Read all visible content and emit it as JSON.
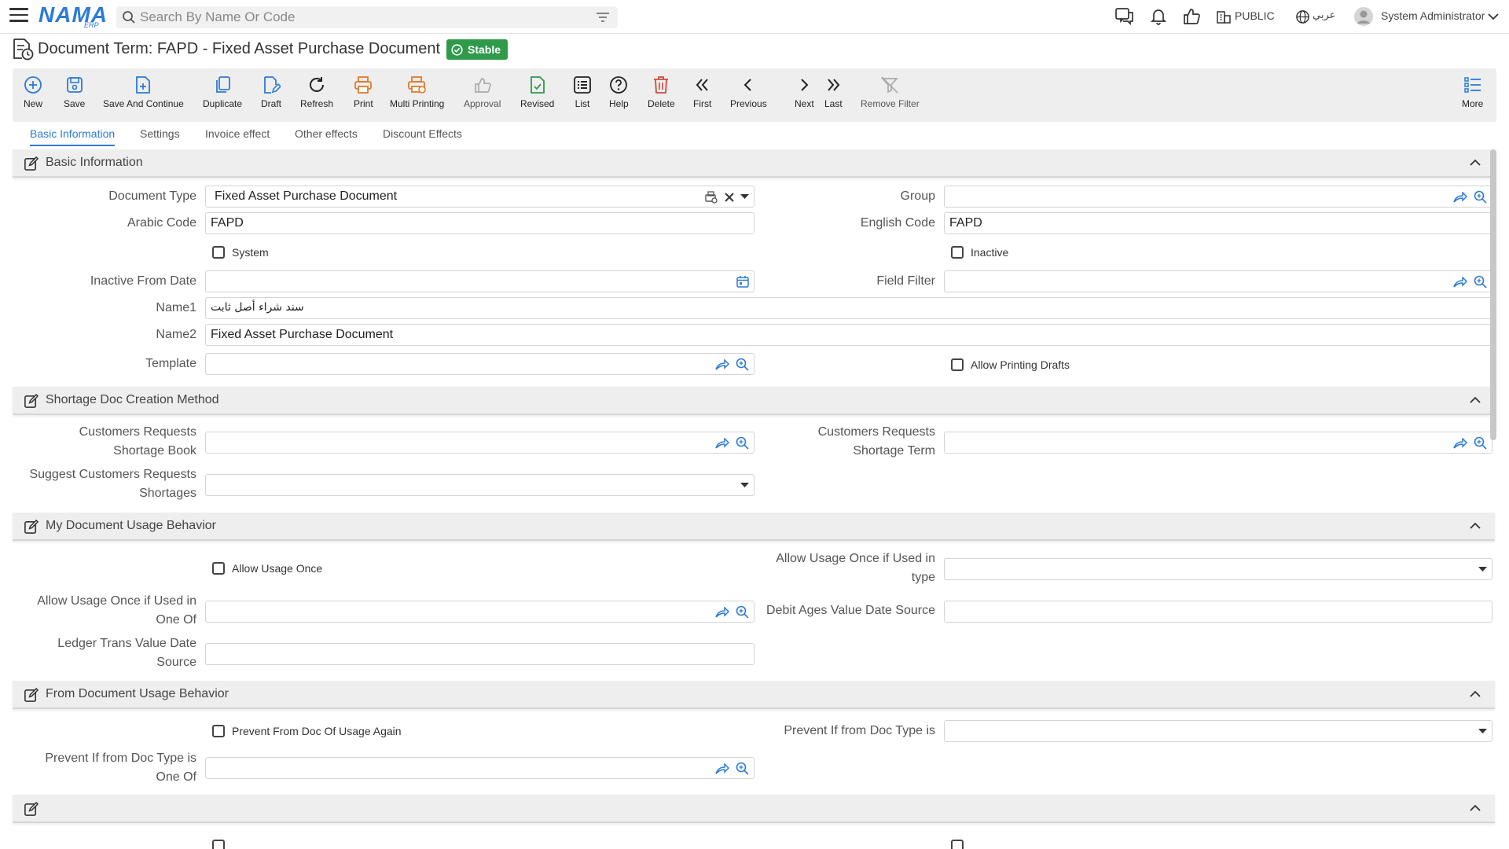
{
  "topbar": {
    "logo": "NAMA",
    "logo_sub": "ERP",
    "search_placeholder": "Search By Name Or Code",
    "public_label": "PUBLIC",
    "language_label": "عربي",
    "user_name": "System Administrator"
  },
  "title": {
    "text": "Document Term: FAPD - Fixed Asset Purchase Document",
    "badge": "Stable"
  },
  "toolbar": {
    "new": "New",
    "save": "Save",
    "save_continue": "Save And Continue",
    "duplicate": "Duplicate",
    "draft": "Draft",
    "refresh": "Refresh",
    "print": "Print",
    "multi_printing": "Multi Printing",
    "approval": "Approval",
    "revised": "Revised",
    "list": "List",
    "help": "Help",
    "delete": "Delete",
    "first": "First",
    "previous": "Previous",
    "next": "Next",
    "last": "Last",
    "remove_filter": "Remove Filter",
    "more": "More"
  },
  "tabs": [
    "Basic Information",
    "Settings",
    "Invoice effect",
    "Other effects",
    "Discount Effects"
  ],
  "sections": {
    "basic": {
      "title": "Basic Information",
      "document_type_label": "Document Type",
      "document_type_value": "Fixed Asset Purchase Document",
      "group_label": "Group",
      "arabic_code_label": "Arabic Code",
      "arabic_code_value": "FAPD",
      "english_code_label": "English Code",
      "english_code_value": "FAPD",
      "system_label": "System",
      "inactive_label": "Inactive",
      "inactive_from_label": "Inactive From Date",
      "field_filter_label": "Field Filter",
      "name1_label": "Name1",
      "name1_value": "سند شراء أصل ثابت",
      "name2_label": "Name2",
      "name2_value": "Fixed Asset Purchase Document",
      "template_label": "Template",
      "allow_printing_drafts_label": "Allow Printing Drafts"
    },
    "shortage": {
      "title": "Shortage Doc Creation Method",
      "cr_shortage_book_l1": "Customers Requests",
      "cr_shortage_book_l2": "Shortage Book",
      "cr_shortage_term_l1": "Customers Requests",
      "cr_shortage_term_l2": "Shortage Term",
      "suggest_l1": "Suggest Customers Requests",
      "suggest_l2": "Shortages"
    },
    "my_usage": {
      "title": "My Document Usage Behavior",
      "allow_usage_once_label": "Allow Usage Once",
      "allow_once_type_l1": "Allow Usage Once if Used in",
      "allow_once_type_l2": "type",
      "allow_once_oneof_l1": "Allow Usage Once if Used in",
      "allow_once_oneof_l2": "One Of",
      "debit_ages_label": "Debit Ages Value Date Source",
      "ledger_l1": "Ledger Trans Value Date",
      "ledger_l2": "Source"
    },
    "from_usage": {
      "title": "From Document Usage Behavior",
      "prevent_again_label": "Prevent From Doc Of Usage Again",
      "prevent_type_label": "Prevent If from Doc Type is",
      "prevent_oneof_l1": "Prevent If from Doc Type is",
      "prevent_oneof_l2": "One Of"
    },
    "next": {
      "title": ""
    }
  },
  "colors": {
    "accent": "#2d7bd6",
    "badge": "#2e9a4a",
    "print": "#e07a2a",
    "delete": "#d04a3a",
    "revised": "#2e9a4a"
  }
}
